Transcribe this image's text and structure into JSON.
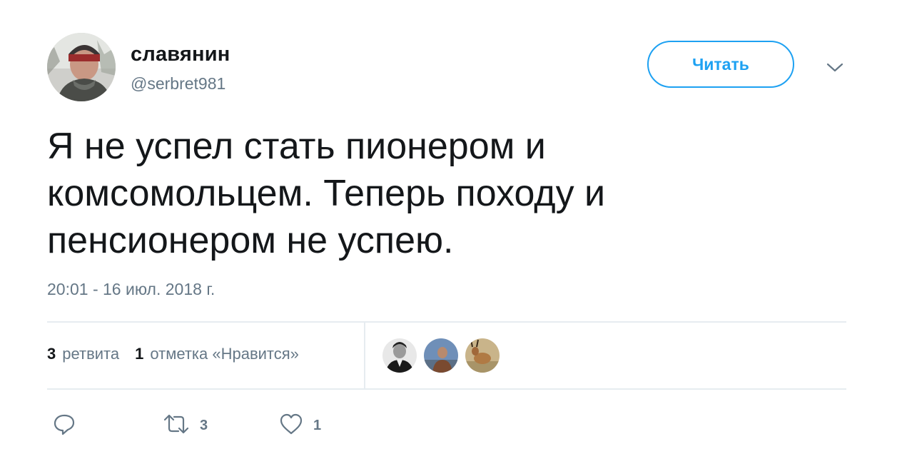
{
  "header": {
    "display_name": "славянин",
    "handle": "@serbret981",
    "follow_label": "Читать"
  },
  "tweet": {
    "lines": [
      "Я не успел стать пионером и",
      "комсомольцем. Теперь походу и",
      "пенсионером не успею."
    ],
    "timestamp": "20:01 - 16 июл. 2018 г."
  },
  "stats": {
    "retweet_count": "3",
    "retweet_label": "ретвита",
    "like_count": "1",
    "like_label": "отметка «Нравится»"
  },
  "actions": {
    "reply_icon": "reply-icon",
    "retweet_icon": "retweet-icon",
    "retweet_count": "3",
    "like_icon": "heart-icon",
    "like_count": "1"
  },
  "colors": {
    "accent": "#1da1f2",
    "text": "#14171a",
    "secondary": "#657786",
    "divider": "#e6ecf0"
  }
}
